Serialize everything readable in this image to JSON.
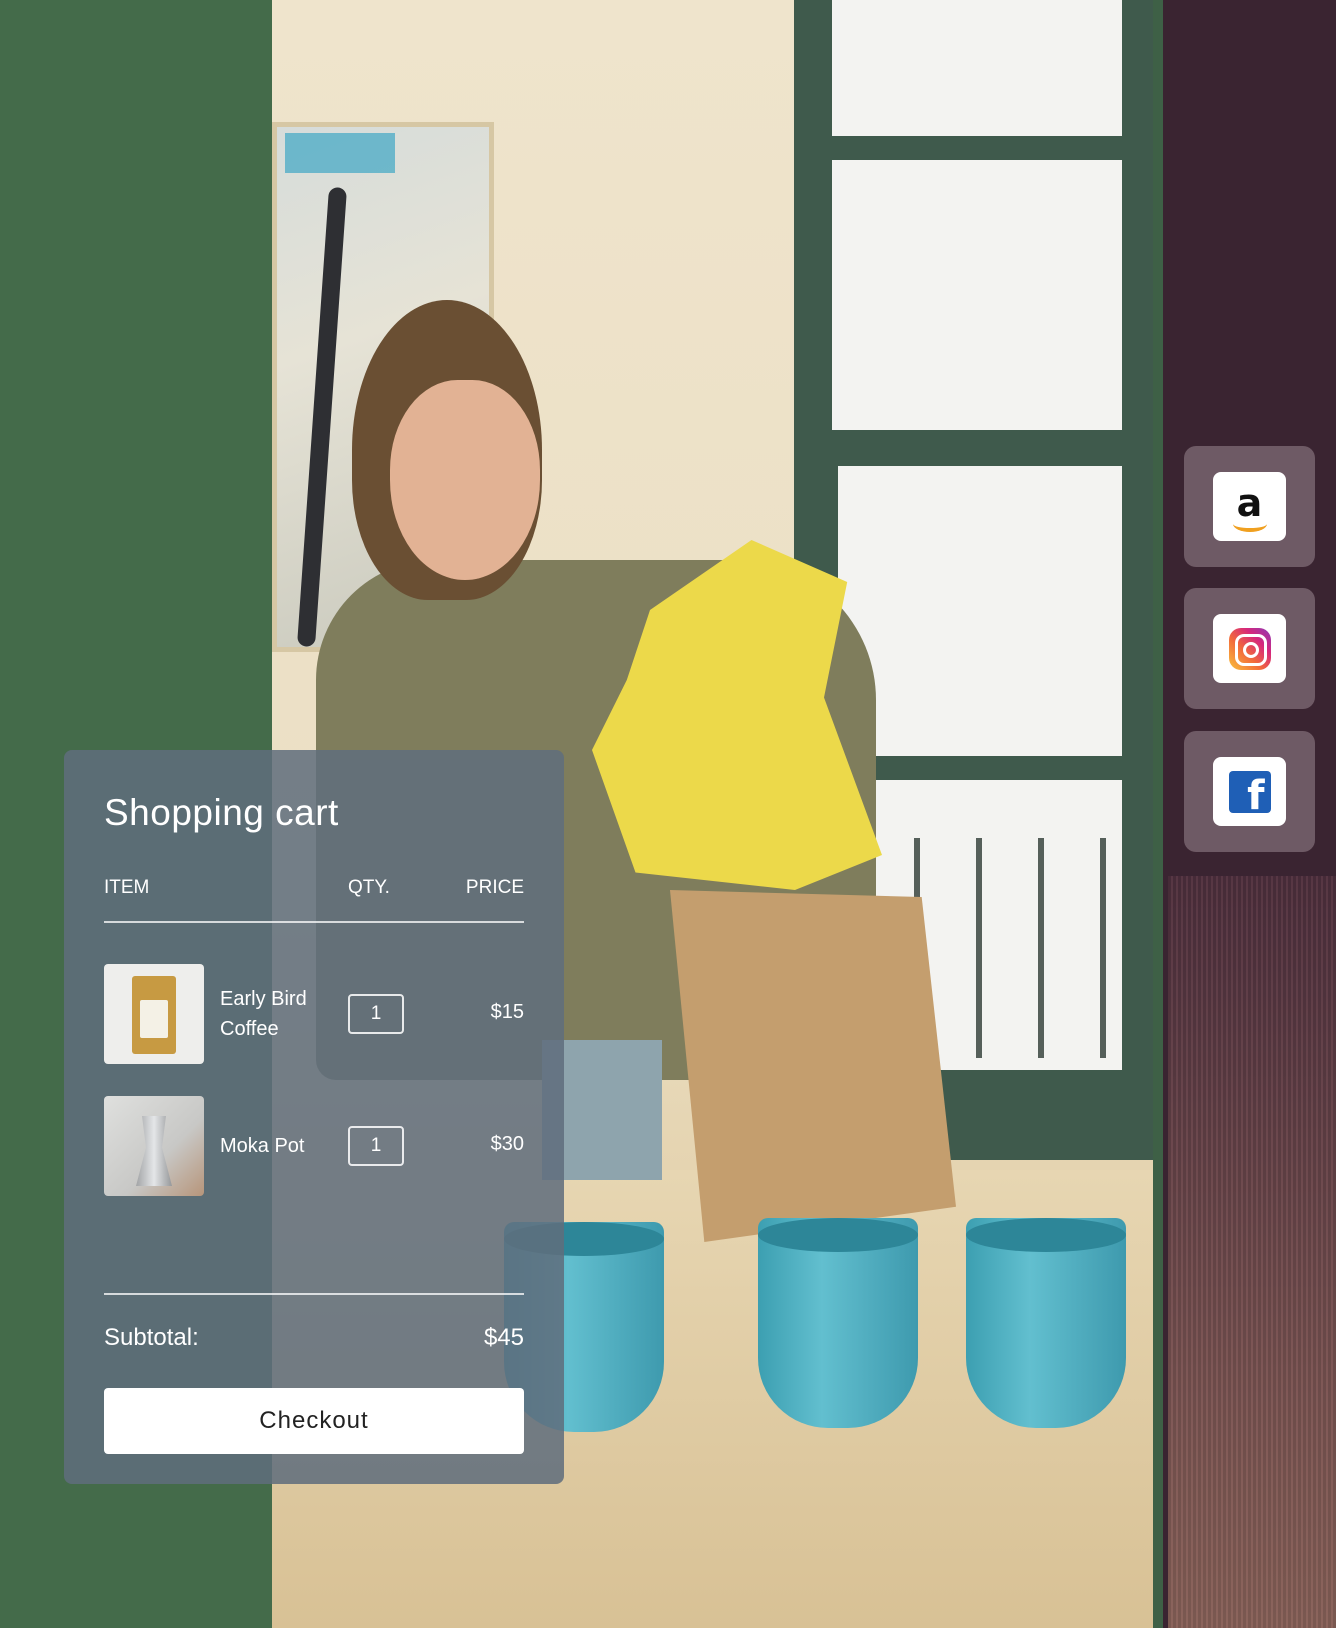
{
  "cart": {
    "title": "Shopping cart",
    "headers": {
      "item": "ITEM",
      "qty": "QTY.",
      "price": "PRICE"
    },
    "items": [
      {
        "name_line1": "Early Bird",
        "name_line2": "Coffee",
        "qty": "1",
        "price": "$15"
      },
      {
        "name_line1": "Moka Pot",
        "qty": "1",
        "price": "$30"
      }
    ],
    "subtotal_label": "Subtotal:",
    "subtotal_value": "$45",
    "checkout_label": "Checkout"
  },
  "social": [
    {
      "icon": "amazon-icon",
      "glyph": "a"
    },
    {
      "icon": "instagram-icon"
    },
    {
      "icon": "facebook-icon",
      "glyph": "f"
    }
  ],
  "colors": {
    "left_band": "#446b4a",
    "right_band": "#3a2431",
    "cart_bg": "#606e7d",
    "social_tile": "#6e5a65",
    "facebook_blue": "#1f5fb6",
    "amazon_orange": "#f0a020"
  }
}
